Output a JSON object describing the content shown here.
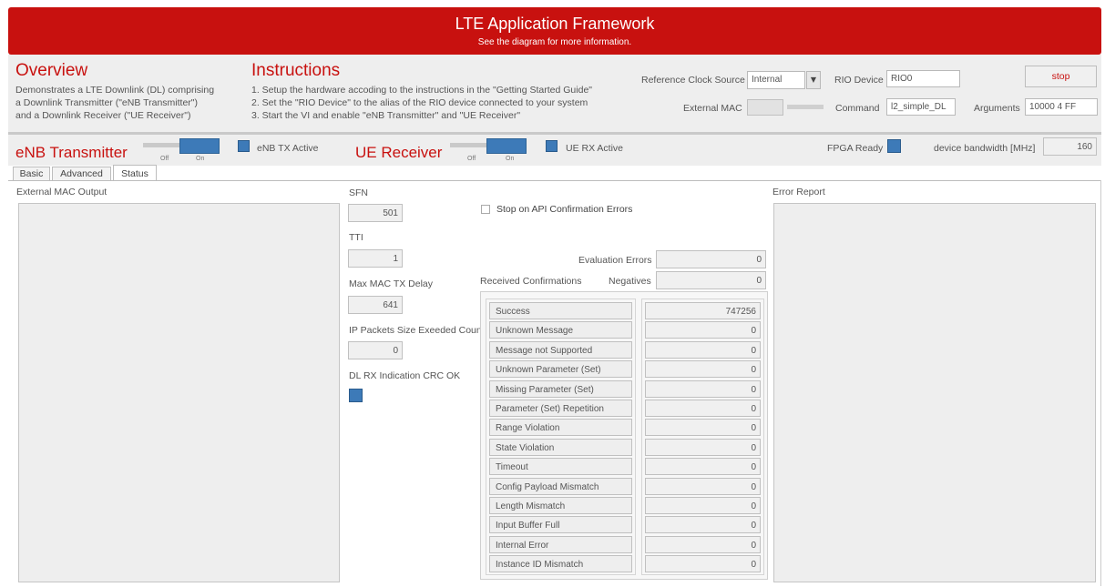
{
  "header": {
    "title": "LTE Application Framework",
    "subtitle": "See the diagram for more information."
  },
  "overview": {
    "heading": "Overview",
    "lines": [
      "Demonstrates a LTE Downlink (DL) comprising",
      "a Downlink Transmitter (\"eNB Transmitter\")",
      "and a Downlink Receiver (\"UE Receiver\")"
    ]
  },
  "instructions": {
    "heading": "Instructions",
    "lines": [
      "1. Setup the hardware accoding to the instructions in the \"Getting Started Guide\"",
      "2. Set the \"RIO Device\" to the alias of the RIO device connected to your system",
      "3. Start the VI and enable \"eNB Transmitter\" and \"UE Receiver\""
    ]
  },
  "config": {
    "ref_clock_label": "Reference Clock Source",
    "ref_clock_value": "Internal",
    "rio_device_label": "RIO Device",
    "rio_device_value": "RIO0",
    "stop_label": "stop",
    "external_mac_label": "External MAC",
    "command_label": "Command",
    "command_value": "l2_simple_DL",
    "arguments_label": "Arguments",
    "arguments_value": "10000 4 FF"
  },
  "toggles": {
    "enb_heading": "eNB Transmitter",
    "off_label": "Off",
    "on_label": "On",
    "enb_active_label": "eNB TX Active",
    "ue_heading": "UE Receiver",
    "ue_active_label": "UE RX Active",
    "fpga_ready_label": "FPGA Ready",
    "bandwidth_label": "device bandwidth [MHz]",
    "bandwidth_value": "160"
  },
  "tabs": [
    "Basic",
    "Advanced",
    "Status"
  ],
  "status": {
    "external_mac_output_label": "External MAC Output",
    "sfn_label": "SFN",
    "sfn_value": "501",
    "tti_label": "TTI",
    "tti_value": "1",
    "max_mac_label": "Max MAC TX Delay",
    "max_mac_value": "641",
    "ip_packets_label": "IP Packets Size Exeeded Count",
    "ip_packets_value": "0",
    "dl_rx_label": "DL RX Indication CRC OK",
    "stop_on_api_label": "Stop on API Confirmation Errors",
    "evaluation_errors_label": "Evaluation Errors",
    "evaluation_errors_value": "0",
    "received_confirmations_label": "Received Confirmations",
    "negatives_label": "Negatives",
    "negatives_value": "0",
    "error_report_label": "Error Report",
    "confirmations": [
      {
        "label": "Success",
        "value": "747256"
      },
      {
        "label": "Unknown Message",
        "value": "0"
      },
      {
        "label": "Message not Supported",
        "value": "0"
      },
      {
        "label": "Unknown Parameter (Set)",
        "value": "0"
      },
      {
        "label": "Missing Parameter (Set)",
        "value": "0"
      },
      {
        "label": "Parameter (Set) Repetition",
        "value": "0"
      },
      {
        "label": "Range Violation",
        "value": "0"
      },
      {
        "label": "State Violation",
        "value": "0"
      },
      {
        "label": "Timeout",
        "value": "0"
      },
      {
        "label": "Config Payload Mismatch",
        "value": "0"
      },
      {
        "label": "Length Mismatch",
        "value": "0"
      },
      {
        "label": "Input Buffer Full",
        "value": "0"
      },
      {
        "label": "Internal Error",
        "value": "0"
      },
      {
        "label": "Instance ID Mismatch",
        "value": "0"
      }
    ]
  },
  "colors": {
    "brand_red": "#c8110f",
    "indicator_blue": "#3d7ab8"
  },
  "icons": {
    "dropdown": "chevron-down-icon"
  }
}
